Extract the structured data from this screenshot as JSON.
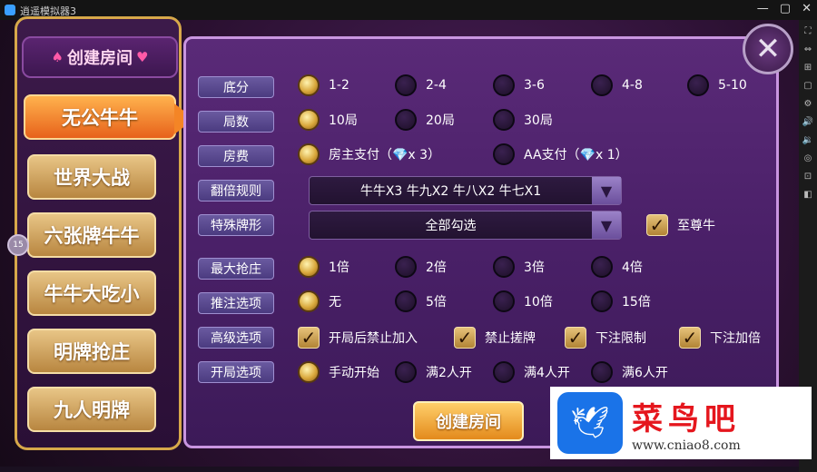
{
  "window": {
    "title": "逍遥模拟器3"
  },
  "window_controls": [
    "—",
    "▢",
    "✕"
  ],
  "sidebar_tools": [
    "⛶",
    "⇔",
    "⊞",
    "▢",
    "⚙",
    "🔊",
    "🔉",
    "◎",
    "⊡",
    "◧"
  ],
  "left": {
    "create_title": "创建房间",
    "modes": [
      "无公牛牛",
      "世界大战",
      "六张牌牛牛",
      "牛牛大吃小",
      "明牌抢庄",
      "九人明牌"
    ],
    "active_mode": "无公牛牛",
    "badge": "15"
  },
  "close_label": "✕",
  "settings": {
    "difen": {
      "label": "底分",
      "options": [
        "1-2",
        "2-4",
        "3-6",
        "4-8",
        "5-10"
      ],
      "selected": "1-2"
    },
    "jushu": {
      "label": "局数",
      "options": [
        "10局",
        "20局",
        "30局"
      ],
      "selected": "10局"
    },
    "fangfei": {
      "label": "房费",
      "options": [
        "房主支付（💎x 3）",
        "AA支付（💎x 1）"
      ],
      "selected": "房主支付（💎x 3）"
    },
    "fanbei": {
      "label": "翻倍规则",
      "value": "牛牛X3 牛九X2 牛八X2 牛七X1"
    },
    "teshu": {
      "label": "特殊牌形",
      "value": "全部勾选",
      "extra_check": "至尊牛",
      "extra_checked": true
    },
    "qiangzhuang": {
      "label": "最大抢庄",
      "options": [
        "1倍",
        "2倍",
        "3倍",
        "4倍"
      ],
      "selected": "1倍"
    },
    "tuizhu": {
      "label": "推注选项",
      "options": [
        "无",
        "5倍",
        "10倍",
        "15倍"
      ],
      "selected": "无"
    },
    "gaoji": {
      "label": "高级选项",
      "options": [
        "开局后禁止加入",
        "禁止搓牌",
        "下注限制",
        "下注加倍"
      ],
      "checked": [
        true,
        true,
        true,
        true
      ]
    },
    "kaiju": {
      "label": "开局选项",
      "options": [
        "手动开始",
        "满2人开",
        "满4人开",
        "满6人开"
      ],
      "selected": "手动开始"
    }
  },
  "create_button": "创建房间",
  "watermark": {
    "name": "菜鸟吧",
    "url": "www.cniao8.com"
  }
}
